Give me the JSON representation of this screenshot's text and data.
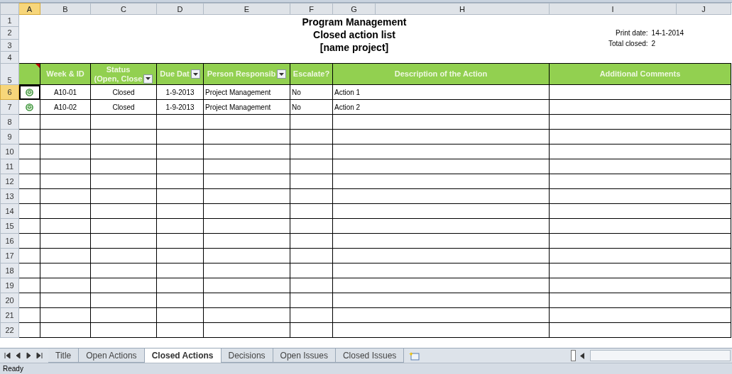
{
  "columns": [
    {
      "label": "A",
      "selected": true
    },
    {
      "label": "B",
      "selected": false
    },
    {
      "label": "C",
      "selected": false
    },
    {
      "label": "D",
      "selected": false
    },
    {
      "label": "E",
      "selected": false
    },
    {
      "label": "F",
      "selected": false
    },
    {
      "label": "G",
      "selected": false
    },
    {
      "label": "H",
      "selected": false
    },
    {
      "label": "I",
      "selected": false
    },
    {
      "label": "J",
      "selected": false
    }
  ],
  "title_lines": [
    "Program Management",
    "Closed action list",
    "[name project]"
  ],
  "info": [
    {
      "label": "Print date:",
      "value": "14-1-2014"
    },
    {
      "label": "Total closed:",
      "value": "2"
    }
  ],
  "header_comment": true,
  "headers": [
    {
      "lines": [
        "Week & ID"
      ],
      "filter": false
    },
    {
      "lines": [
        "Status",
        "(Open, Close"
      ],
      "filter": true
    },
    {
      "lines": [
        "Due Dat"
      ],
      "filter": true
    },
    {
      "lines": [
        "Person Responsib"
      ],
      "filter": true
    },
    {
      "lines": [
        "Escalate?"
      ],
      "filter": false
    },
    {
      "lines": [
        "Description of the Action"
      ],
      "filter": false
    },
    {
      "lines": [
        "Additional Comments"
      ],
      "filter": false
    }
  ],
  "row_numbers": [
    {
      "label": "1",
      "selected": false
    },
    {
      "label": "2",
      "selected": false
    },
    {
      "label": "3",
      "selected": false
    },
    {
      "label": "4",
      "selected": false
    },
    {
      "label": "5",
      "selected": false
    },
    {
      "label": "6",
      "selected": true
    },
    {
      "label": "7",
      "selected": false
    },
    {
      "label": "8",
      "selected": false
    },
    {
      "label": "9",
      "selected": false
    },
    {
      "label": "10",
      "selected": false
    },
    {
      "label": "11",
      "selected": false
    },
    {
      "label": "12",
      "selected": false
    },
    {
      "label": "13",
      "selected": false
    },
    {
      "label": "14",
      "selected": false
    },
    {
      "label": "15",
      "selected": false
    },
    {
      "label": "16",
      "selected": false
    },
    {
      "label": "17",
      "selected": false
    },
    {
      "label": "18",
      "selected": false
    },
    {
      "label": "19",
      "selected": false
    },
    {
      "label": "20",
      "selected": false
    },
    {
      "label": "21",
      "selected": false
    },
    {
      "label": "22",
      "selected": false
    }
  ],
  "rows": [
    {
      "done_icon": true,
      "active": true,
      "cells": [
        "A10-01",
        "Closed",
        "1-9-2013",
        "Project Management",
        "No",
        "Action 1",
        ""
      ]
    },
    {
      "done_icon": true,
      "active": false,
      "cells": [
        "A10-02",
        "Closed",
        "1-9-2013",
        "Project Management",
        "No",
        "Action 2",
        ""
      ]
    }
  ],
  "sheet_tabs": [
    {
      "label": "Title",
      "selected": false
    },
    {
      "label": "Open Actions",
      "selected": false
    },
    {
      "label": "Closed Actions",
      "selected": true
    },
    {
      "label": "Decisions",
      "selected": false
    },
    {
      "label": "Open Issues",
      "selected": false
    },
    {
      "label": "Closed Issues",
      "selected": false
    }
  ],
  "status_bar": "Ready"
}
